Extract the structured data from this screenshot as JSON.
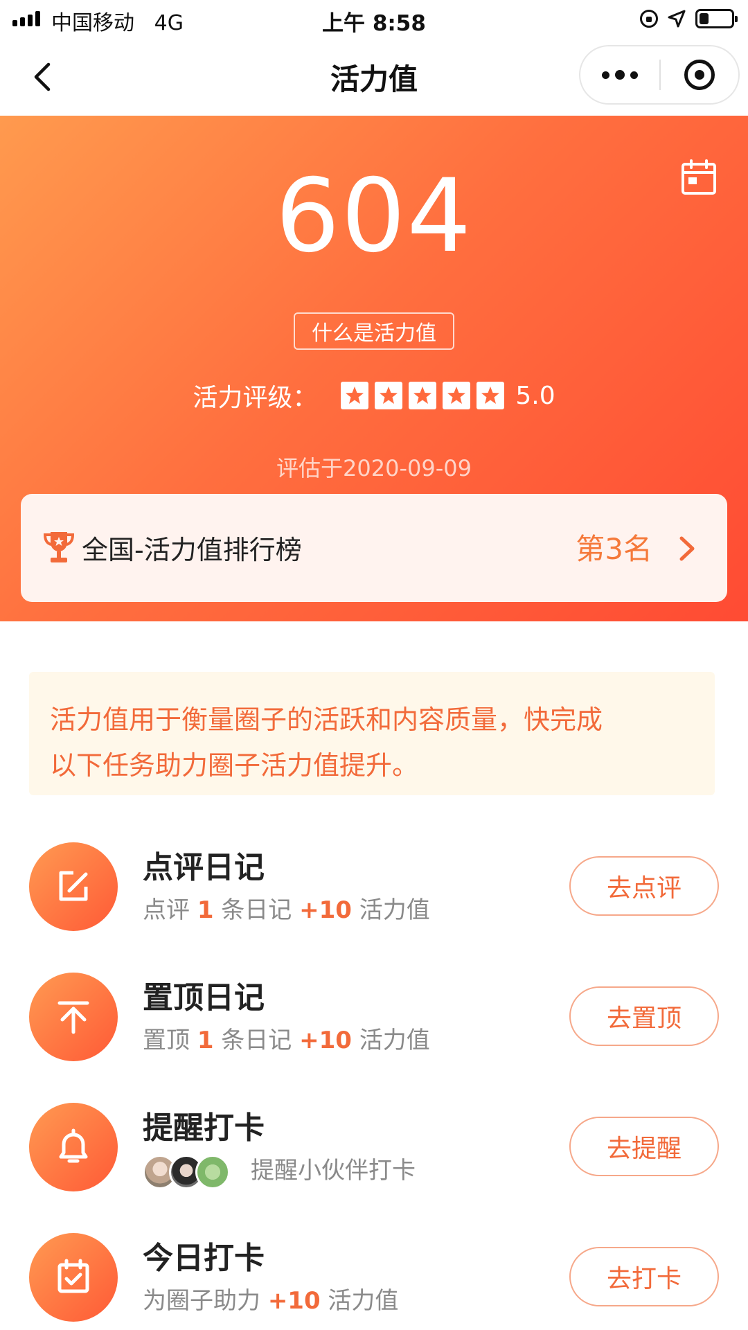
{
  "status_bar": {
    "carrier": "中国移动",
    "network": "4G",
    "time": "上午 8:58",
    "battery_level": 0.3
  },
  "nav": {
    "title": "活力值",
    "back_icon": "chevron-left-icon",
    "more_icon": "more-dots-icon",
    "close_icon": "target-circle-icon"
  },
  "hero": {
    "score": "604",
    "what_button": "什么是活力值",
    "rating_label": "活力评级：",
    "stars_count": 5,
    "rating_value": "5.0",
    "eval_date": "评估于2020-09-09",
    "calendar_icon": "calendar-icon",
    "accent_start": "#ff9a4e",
    "accent_end": "#ff4b33"
  },
  "rank": {
    "title": "全国-活力值排行榜",
    "value": "第3名",
    "icon": "trophy-icon"
  },
  "notice": {
    "line1": "活力值用于衡量圈子的活跃和内容质量，快完成",
    "line2": "以下任务助力圈子活力值提升。"
  },
  "tasks": [
    {
      "title": "点评日记",
      "desc_prefix": "点评 ",
      "desc_num": "1",
      "desc_mid": " 条日记 ",
      "desc_points": "+10",
      "desc_suffix": " 活力值",
      "button": "去点评",
      "icon": "edit-icon"
    },
    {
      "title": "置顶日记",
      "desc_prefix": "置顶 ",
      "desc_num": "1",
      "desc_mid": " 条日记 ",
      "desc_points": "+10",
      "desc_suffix": " 活力值",
      "button": "去置顶",
      "icon": "pin-top-icon"
    },
    {
      "title": "提醒打卡",
      "desc": "提醒小伙伴打卡",
      "button": "去提醒",
      "icon": "bell-icon"
    },
    {
      "title": "今日打卡",
      "desc_prefix": "为圈子助力 ",
      "desc_points": "+10",
      "desc_suffix": " 活力值",
      "button": "去打卡",
      "icon": "calendar-check-icon"
    }
  ],
  "colors": {
    "accent": "#f26a3a",
    "notice_bg": "#fff8ea",
    "rank_card_bg": "#fff3ef"
  }
}
